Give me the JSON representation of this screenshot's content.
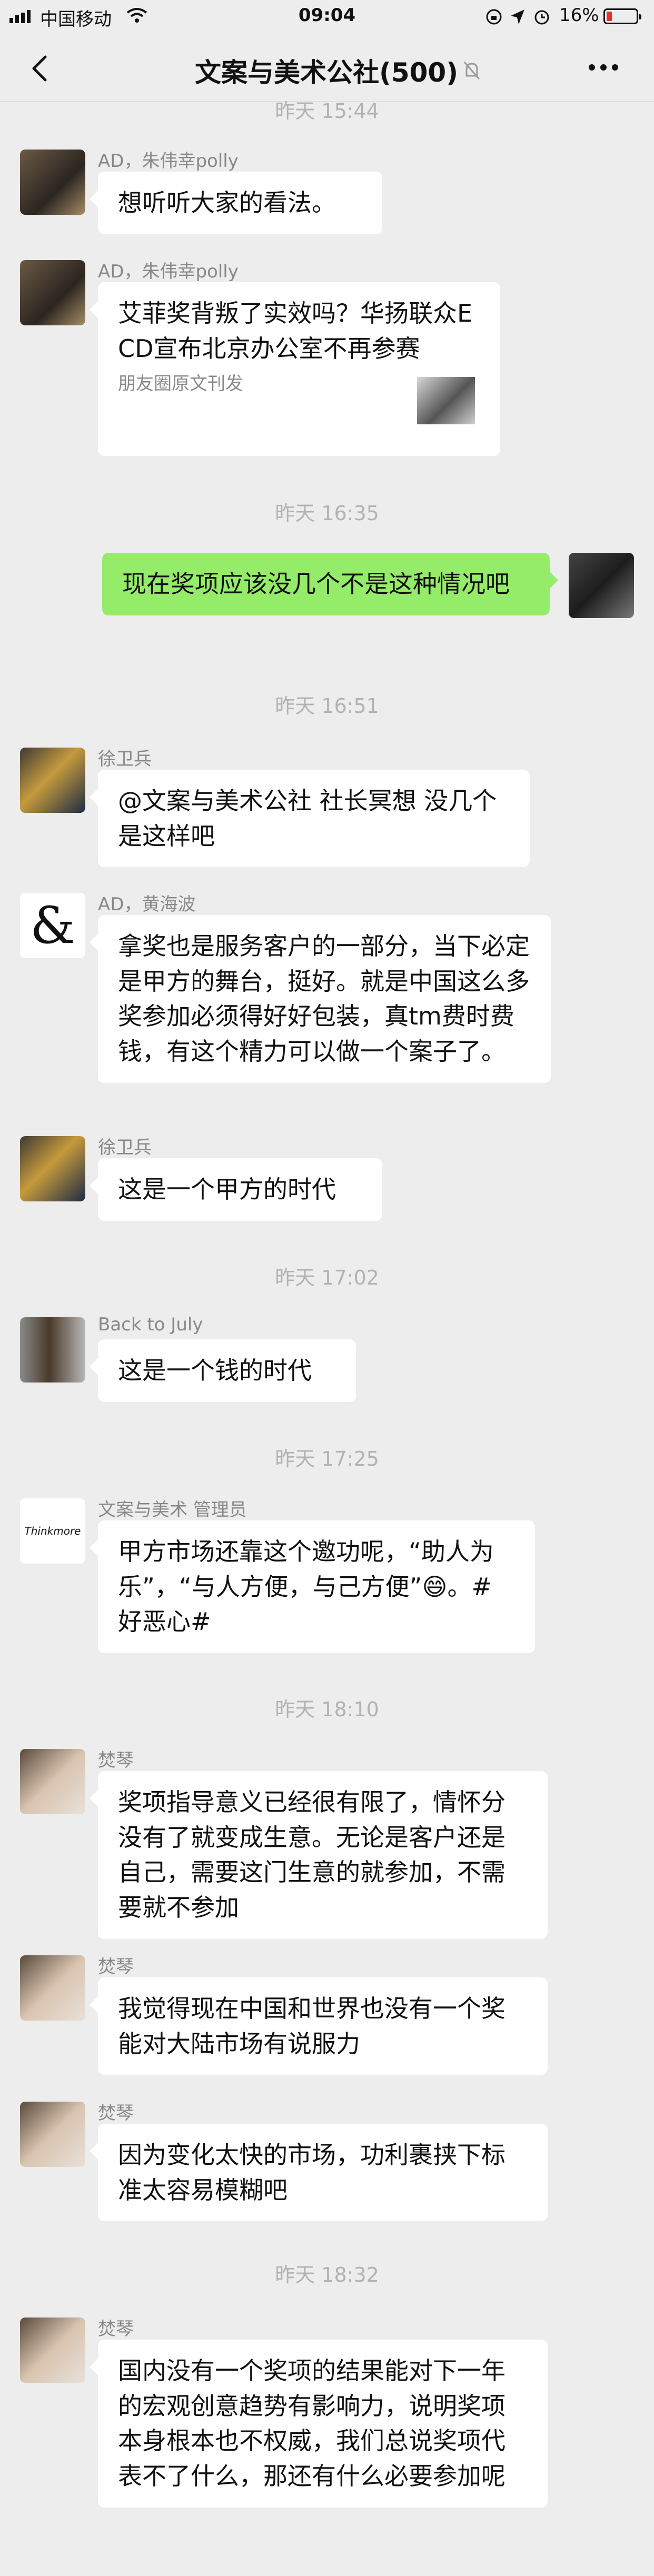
{
  "status_bar": {
    "carrier": "中国移动",
    "time": "09:04",
    "battery": "16%"
  },
  "nav": {
    "title": "文案与美术公社(500)",
    "back_icon": "chevron-left-icon",
    "mute_icon": "bell-off-icon",
    "more_icon": "more-dots-icon"
  },
  "chat": {
    "times": [
      "昨天 15:44",
      "昨天 16:35",
      "昨天 16:51",
      "昨天 17:02",
      "昨天 17:25",
      "昨天 18:10",
      "昨天 18:32"
    ],
    "messages": [
      {
        "sender": "AD，朱伟幸polly",
        "text": "想听听大家的看法。"
      },
      {
        "sender": "AD，朱伟幸polly",
        "card_title": "艾菲奖背叛了实效吗？华扬联众ECD宣布北京办公室不再参赛",
        "card_source": "朋友圈原文刊发"
      },
      {
        "sender": "",
        "text": "现在奖项应该没几个不是这种情况吧",
        "self": true
      },
      {
        "sender": "徐卫兵",
        "text": "@文案与美术公社 社长冥想 没几个是这样吧"
      },
      {
        "sender": "AD，黄海波",
        "text": "拿奖也是服务客户的一部分，当下必定是甲方的舞台，挺好。就是中国这么多奖参加必须得好好包装，真tm费时费钱，有这个精力可以做一个案子了。"
      },
      {
        "sender": "徐卫兵",
        "text": "这是一个甲方的时代"
      },
      {
        "sender": "Back to July",
        "text": "这是一个钱的时代"
      },
      {
        "sender": "文案与美术 管理员",
        "text": "甲方市场还靠这个邀功呢，“助人为乐”，“与人方便，与己方便”😄。#好恶心#"
      },
      {
        "sender": "焚琴",
        "text": "奖项指导意义已经很有限了，情怀分没有了就变成生意。无论是客户还是自己，需要这门生意的就参加，不需要就不参加"
      },
      {
        "sender": "焚琴",
        "text": "我觉得现在中国和世界也没有一个奖能对大陆市场有说服力"
      },
      {
        "sender": "焚琴",
        "text": "因为变化太快的市场，功利裹挟下标准太容易模糊吧"
      },
      {
        "sender": "焚琴",
        "text": "国内没有一个奖项的结果能对下一年的宏观创意趋势有影响力，说明奖项本身根本也不权威，我们总说奖项代表不了什么，那还有什么必要参加呢"
      }
    ],
    "avatar_text": {
      "ampersand": "&",
      "thinkmore": "Thinkmore"
    }
  },
  "colors": {
    "background": "#ededed",
    "bubble_other": "#ffffff",
    "bubble_self": "#95ec69",
    "time_text": "#b2b2b2",
    "sender_text": "#888888"
  }
}
